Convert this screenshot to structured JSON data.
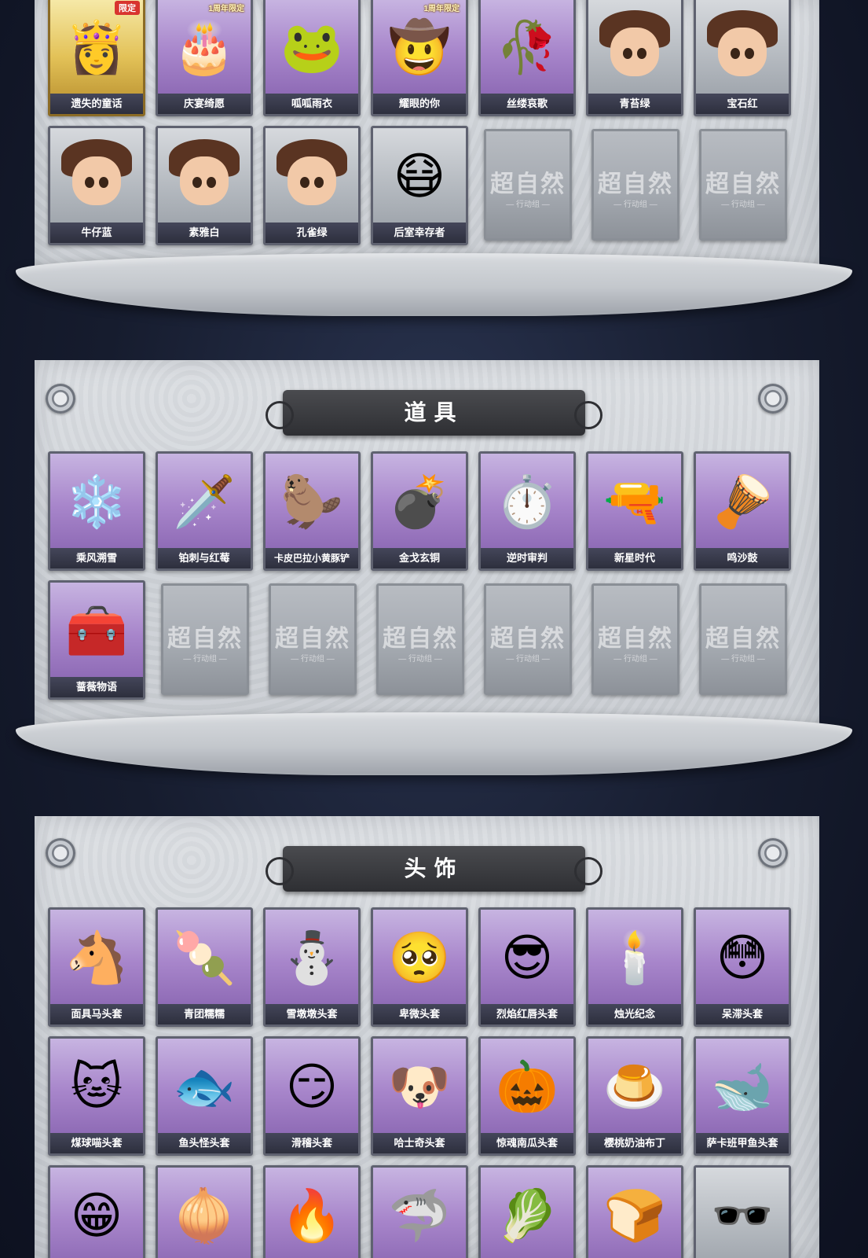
{
  "sections": [
    {
      "title": "",
      "cards": [
        {
          "label": "遗失的童话",
          "tag": "限定",
          "variant": "gold",
          "art": "👸"
        },
        {
          "label": "庆宴绮愿",
          "tag": "1周年限定",
          "variant": "purple",
          "art": "🎂"
        },
        {
          "label": "呱呱雨衣",
          "tag": "",
          "variant": "purple",
          "art": "🐸"
        },
        {
          "label": "耀眼的你",
          "tag": "1周年限定",
          "variant": "purple",
          "art": "🤠"
        },
        {
          "label": "丝缕哀歌",
          "tag": "",
          "variant": "purple",
          "art": "🥀"
        },
        {
          "label": "青苔绿",
          "tag": "",
          "variant": "gray",
          "art": "girl"
        },
        {
          "label": "宝石红",
          "tag": "",
          "variant": "gray",
          "art": "girl"
        },
        {
          "label": "牛仔蓝",
          "tag": "",
          "variant": "gray",
          "art": "girl"
        },
        {
          "label": "素雅白",
          "tag": "",
          "variant": "gray",
          "art": "girl"
        },
        {
          "label": "孔雀绿",
          "tag": "",
          "variant": "gray",
          "art": "girl"
        },
        {
          "label": "后室幸存者",
          "tag": "",
          "variant": "gray",
          "art": "😷"
        }
      ],
      "empty_count": 3
    },
    {
      "title": "道具",
      "cards": [
        {
          "label": "乘风溯雪",
          "tag": "",
          "variant": "purple",
          "art": "❄️"
        },
        {
          "label": "铂刺与红莓",
          "tag": "",
          "variant": "purple",
          "art": "🗡️"
        },
        {
          "label": "卡皮巴拉小黄豚铲",
          "tag": "",
          "variant": "purple",
          "art": "🦫"
        },
        {
          "label": "金戈玄铜",
          "tag": "",
          "variant": "purple",
          "art": "💣"
        },
        {
          "label": "逆时审判",
          "tag": "",
          "variant": "purple",
          "art": "⏱️"
        },
        {
          "label": "新星时代",
          "tag": "",
          "variant": "purple",
          "art": "🔫"
        },
        {
          "label": "鸣沙鼓",
          "tag": "",
          "variant": "purple",
          "art": "🪘"
        },
        {
          "label": "蔷薇物语",
          "tag": "",
          "variant": "purple",
          "art": "🧰"
        }
      ],
      "empty_count": 6
    },
    {
      "title": "头饰",
      "cards": [
        {
          "label": "面具马头套",
          "tag": "",
          "variant": "purple",
          "art": "🐴"
        },
        {
          "label": "青团糯糯",
          "tag": "",
          "variant": "purple",
          "art": "🍡"
        },
        {
          "label": "雪墩墩头套",
          "tag": "",
          "variant": "purple",
          "art": "⛄"
        },
        {
          "label": "卑微头套",
          "tag": "",
          "variant": "purple",
          "art": "🥺"
        },
        {
          "label": "烈焰红唇头套",
          "tag": "",
          "variant": "purple",
          "art": "😎"
        },
        {
          "label": "烛光纪念",
          "tag": "",
          "variant": "purple",
          "art": "🕯️"
        },
        {
          "label": "呆滞头套",
          "tag": "",
          "variant": "purple",
          "art": "😳"
        },
        {
          "label": "煤球喵头套",
          "tag": "",
          "variant": "purple",
          "art": "🐱"
        },
        {
          "label": "鱼头怪头套",
          "tag": "",
          "variant": "purple",
          "art": "🐟"
        },
        {
          "label": "滑稽头套",
          "tag": "",
          "variant": "purple",
          "art": "😏"
        },
        {
          "label": "哈士奇头套",
          "tag": "",
          "variant": "purple",
          "art": "🐶"
        },
        {
          "label": "惊魂南瓜头套",
          "tag": "",
          "variant": "purple",
          "art": "🎃"
        },
        {
          "label": "樱桃奶油布丁",
          "tag": "",
          "variant": "purple",
          "art": "🍮"
        },
        {
          "label": "萨卡班甲鱼头套",
          "tag": "",
          "variant": "purple",
          "art": "🐋"
        },
        {
          "label": "",
          "tag": "",
          "variant": "purple",
          "art": "😁"
        },
        {
          "label": "",
          "tag": "",
          "variant": "purple",
          "art": "🧅"
        },
        {
          "label": "",
          "tag": "",
          "variant": "purple",
          "art": "🔥"
        },
        {
          "label": "",
          "tag": "",
          "variant": "purple",
          "art": "🦈"
        },
        {
          "label": "",
          "tag": "",
          "variant": "purple",
          "art": "🥬"
        },
        {
          "label": "",
          "tag": "",
          "variant": "purple",
          "art": "🍞"
        },
        {
          "label": "",
          "tag": "",
          "variant": "gray",
          "art": "🕶️"
        }
      ],
      "empty_count": 0
    }
  ],
  "empty_slot": {
    "mark": "超自然",
    "sub": "— 行动组 —"
  }
}
